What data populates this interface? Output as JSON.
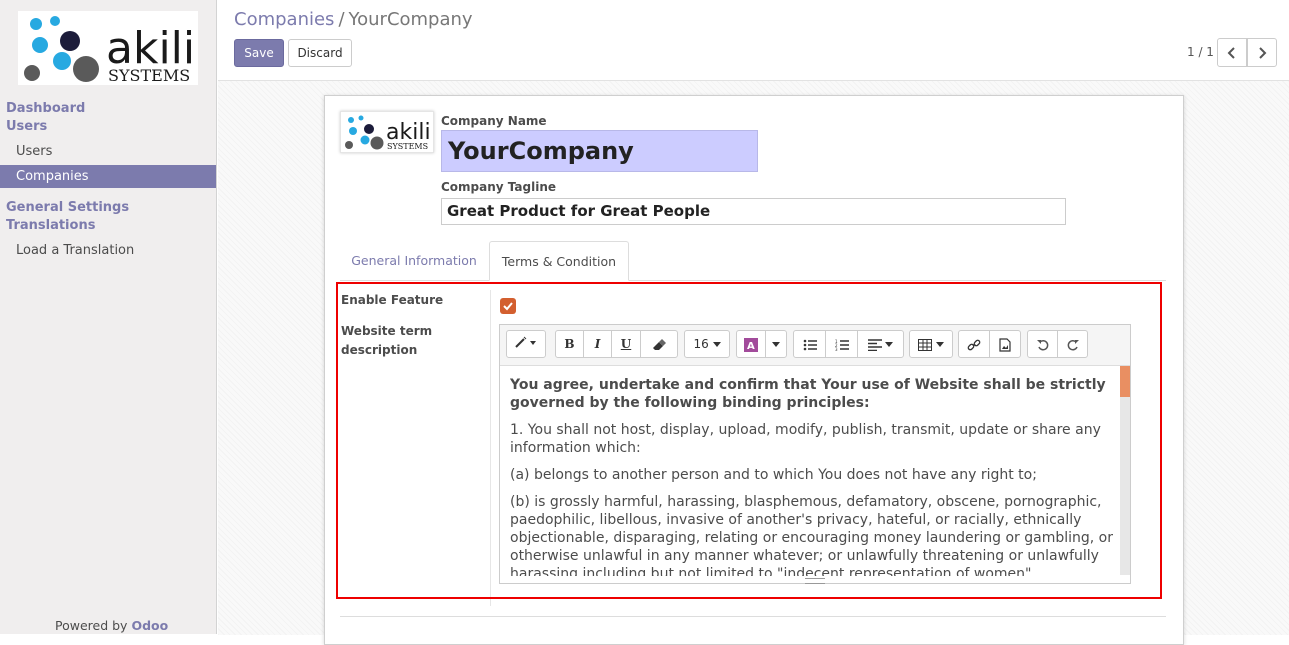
{
  "sidebar": {
    "logo_alt": "akili SYSTEMS",
    "logo_word": "akili",
    "logo_sub": "SYSTEMS",
    "heads": [
      "Dashboard",
      "Users",
      "General Settings",
      "Translations"
    ],
    "items": [
      {
        "label": "Users",
        "active": false
      },
      {
        "label": "Companies",
        "active": true
      },
      {
        "label": "Load a Translation",
        "active": false
      }
    ],
    "powered_prefix": "Powered by",
    "powered_brand": "Odoo"
  },
  "header": {
    "breadcrumb_parent": "Companies",
    "breadcrumb_sep": "/",
    "breadcrumb_current": "YourCompany",
    "save_label": "Save",
    "discard_label": "Discard",
    "pager_text": "1 / 1",
    "prev_icon": "chevron-left-icon",
    "next_icon": "chevron-right-icon"
  },
  "form": {
    "company_name_label": "Company Name",
    "company_name_value": "YourCompany",
    "tagline_label": "Company Tagline",
    "tagline_value": "Great Product for Great People",
    "tabs": [
      "General Information",
      "Terms & Condition"
    ],
    "active_tab": "Terms & Condition",
    "enable_feature_label": "Enable Feature",
    "enable_feature_checked": true,
    "website_term_label_1": "Website term",
    "website_term_label_2": "description"
  },
  "editor": {
    "font_size": "16",
    "toolbar_icons": [
      "magic-wand-icon",
      "bold-icon",
      "italic-icon",
      "underline-icon",
      "eraser-icon",
      "font-color-icon",
      "unordered-list-icon",
      "ordered-list-icon",
      "align-icon",
      "table-icon",
      "link-icon",
      "image-icon",
      "undo-icon",
      "redo-icon"
    ],
    "paragraphs": [
      "You agree, undertake and confirm that Your use of Website shall be strictly governed by the following binding principles:",
      "1. You shall not host, display, upload, modify, publish, transmit, update or share any information which:",
      "(a) belongs to another person and to which You does not have any right to;",
      "(b) is grossly harmful, harassing, blasphemous, defamatory, obscene, pornographic, paedophilic, libellous, invasive of another's privacy, hateful, or racially, ethnically objectionable, disparaging, relating or encouraging money laundering or gambling, or otherwise unlawful in any manner whatever; or unlawfully threatening or unlawfully harassing including but not limited to \"indecent representation of women\""
    ]
  },
  "colors": {
    "accent": "#7c7bad",
    "highlight_box": "#ee0000",
    "checkbox": "#d35f2f",
    "name_field_bg": "#ccccff"
  }
}
